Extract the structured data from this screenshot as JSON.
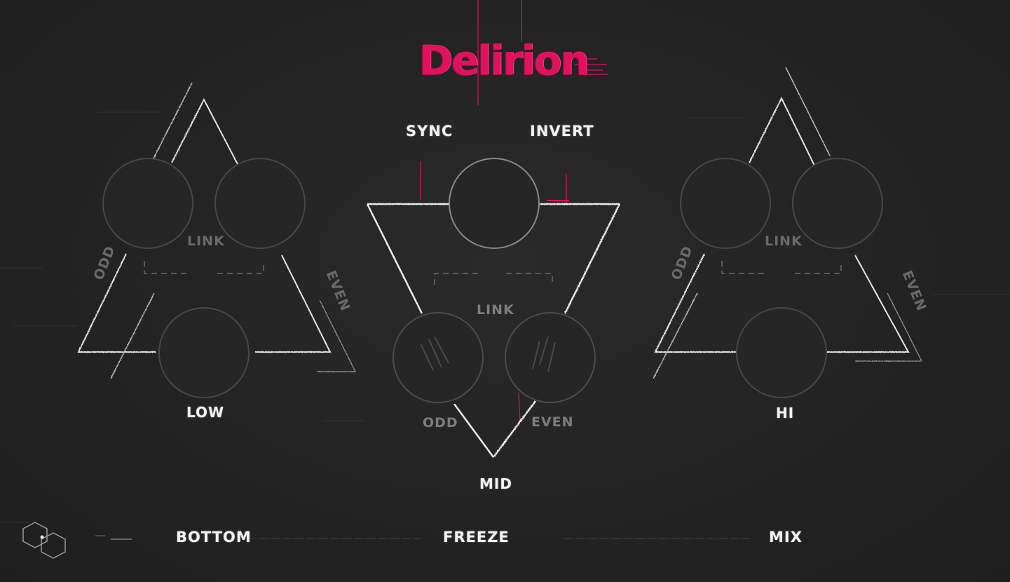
{
  "app": {
    "title": "Delirion",
    "accent_color": "#e0115f"
  },
  "top_controls": {
    "sync_label": "SYNC",
    "invert_label": "INVERT"
  },
  "bands": {
    "low": {
      "name": "LOW",
      "link_label": "LINK",
      "odd_label": "ODD",
      "even_label": "EVEN"
    },
    "mid": {
      "name": "MID",
      "link_label": "LINK",
      "odd_label": "ODD",
      "even_label": "EVEN"
    },
    "hi": {
      "name": "HI",
      "link_label": "LINK",
      "odd_label": "ODD",
      "even_label": "EVEN"
    }
  },
  "bottom_bar": {
    "logo_icon": "hexagon-logo-icon",
    "bottom_label": "BOTTOM",
    "freeze_label": "FREEZE",
    "mix_label": "MIX"
  }
}
